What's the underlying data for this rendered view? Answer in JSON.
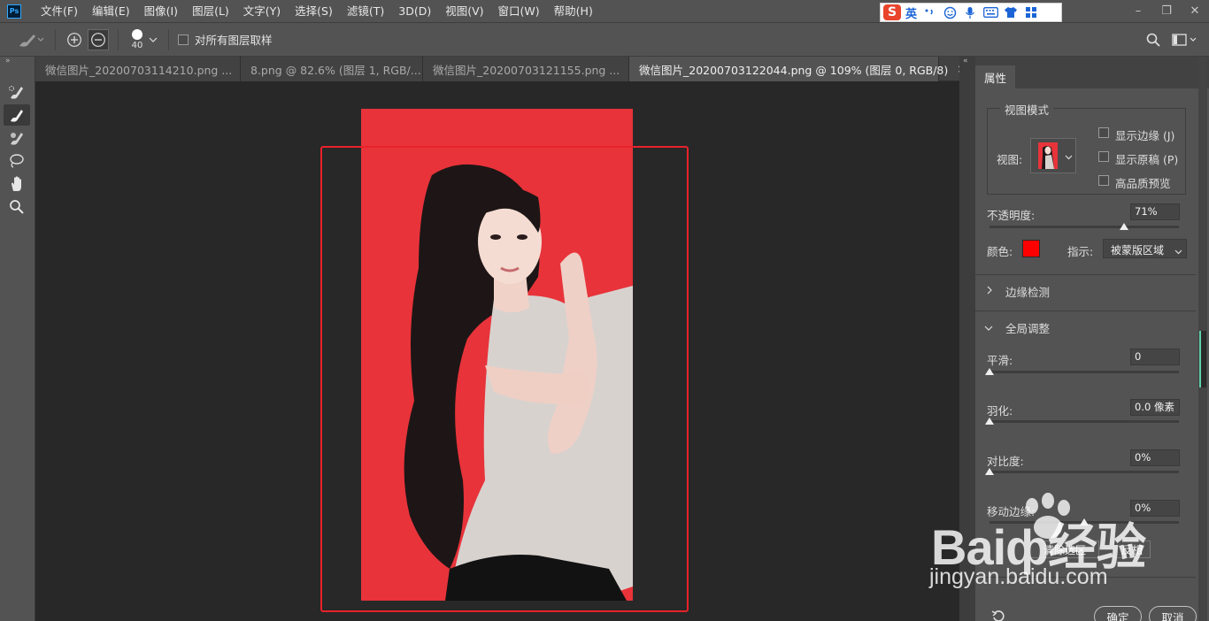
{
  "menubar": {
    "logo": "Ps",
    "items": [
      "文件(F)",
      "编辑(E)",
      "图像(I)",
      "图层(L)",
      "文字(Y)",
      "选择(S)",
      "滤镜(T)",
      "3D(D)",
      "视图(V)",
      "窗口(W)",
      "帮助(H)"
    ],
    "ime": {
      "logo": "S",
      "lang": "英"
    },
    "window_controls": [
      "–",
      "❐",
      "✕"
    ]
  },
  "options": {
    "brush_size": "40",
    "sample_all_label": "对所有图层取样"
  },
  "tabs": [
    {
      "label": "微信图片_20200703114210.png ...",
      "close": "×"
    },
    {
      "label": "8.png @ 82.6% (图层 1, RGB/...",
      "close": "×"
    },
    {
      "label": "微信图片_20200703121155.png ...",
      "close": "×"
    },
    {
      "label": "微信图片_20200703122044.png @ 109% (图层 0, RGB/8)",
      "close": "×"
    }
  ],
  "panel": {
    "tab": "属性",
    "view_mode": {
      "title": "视图模式",
      "view_label": "视图:",
      "show_edge": "显示边缘 (J)",
      "show_original": "显示原稿 (P)",
      "hq_preview": "高品质预览"
    },
    "opacity": {
      "label": "不透明度:",
      "value": "71%",
      "level": 0.71
    },
    "color": {
      "label": "颜色:",
      "swatch": "#ff0000"
    },
    "indicate": {
      "label": "指示:",
      "value": "被蒙版区域"
    },
    "edge_detection": "边缘检测",
    "global": {
      "title": "全局调整",
      "smooth": {
        "label": "平滑:",
        "value": "0",
        "level": 0
      },
      "feather": {
        "label": "羽化:",
        "value": "0.0 像素",
        "level": 0
      },
      "contrast": {
        "label": "对比度:",
        "value": "0%",
        "level": 0
      },
      "shift_edge": {
        "label": "移动边缘:",
        "value": "0%",
        "level": 0.5
      }
    },
    "clear_selection": "清除选区",
    "invert": "反相",
    "ok": "确定",
    "cancel": "取消"
  },
  "watermark": {
    "brand": "Baiф经验",
    "url": "jingyan.baidu.com"
  },
  "colors": {
    "selection_frame": "#e8222a",
    "photo_bg": "#e8333a",
    "accent": "#31a8ff"
  }
}
